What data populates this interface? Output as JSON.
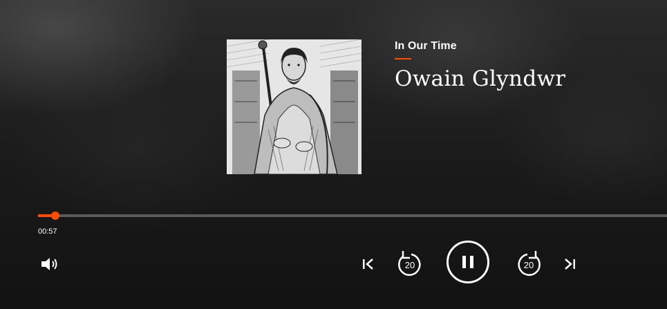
{
  "brand": {
    "name": "In Our Time",
    "accent_color": "#ff4c00"
  },
  "episode": {
    "title": "Owain Glyndwr"
  },
  "artwork": {
    "description_icon": "episode-artwork-engraving"
  },
  "progress": {
    "elapsed": "00:57",
    "fraction": 0.027
  },
  "controls": {
    "volume_icon": "volume-icon",
    "previous_icon": "skip-previous-icon",
    "rewind": {
      "icon": "rewind-20-icon",
      "seconds": "20"
    },
    "play_state_icon": "pause-icon",
    "forward": {
      "icon": "forward-20-icon",
      "seconds": "20"
    },
    "next_icon": "skip-next-icon"
  }
}
